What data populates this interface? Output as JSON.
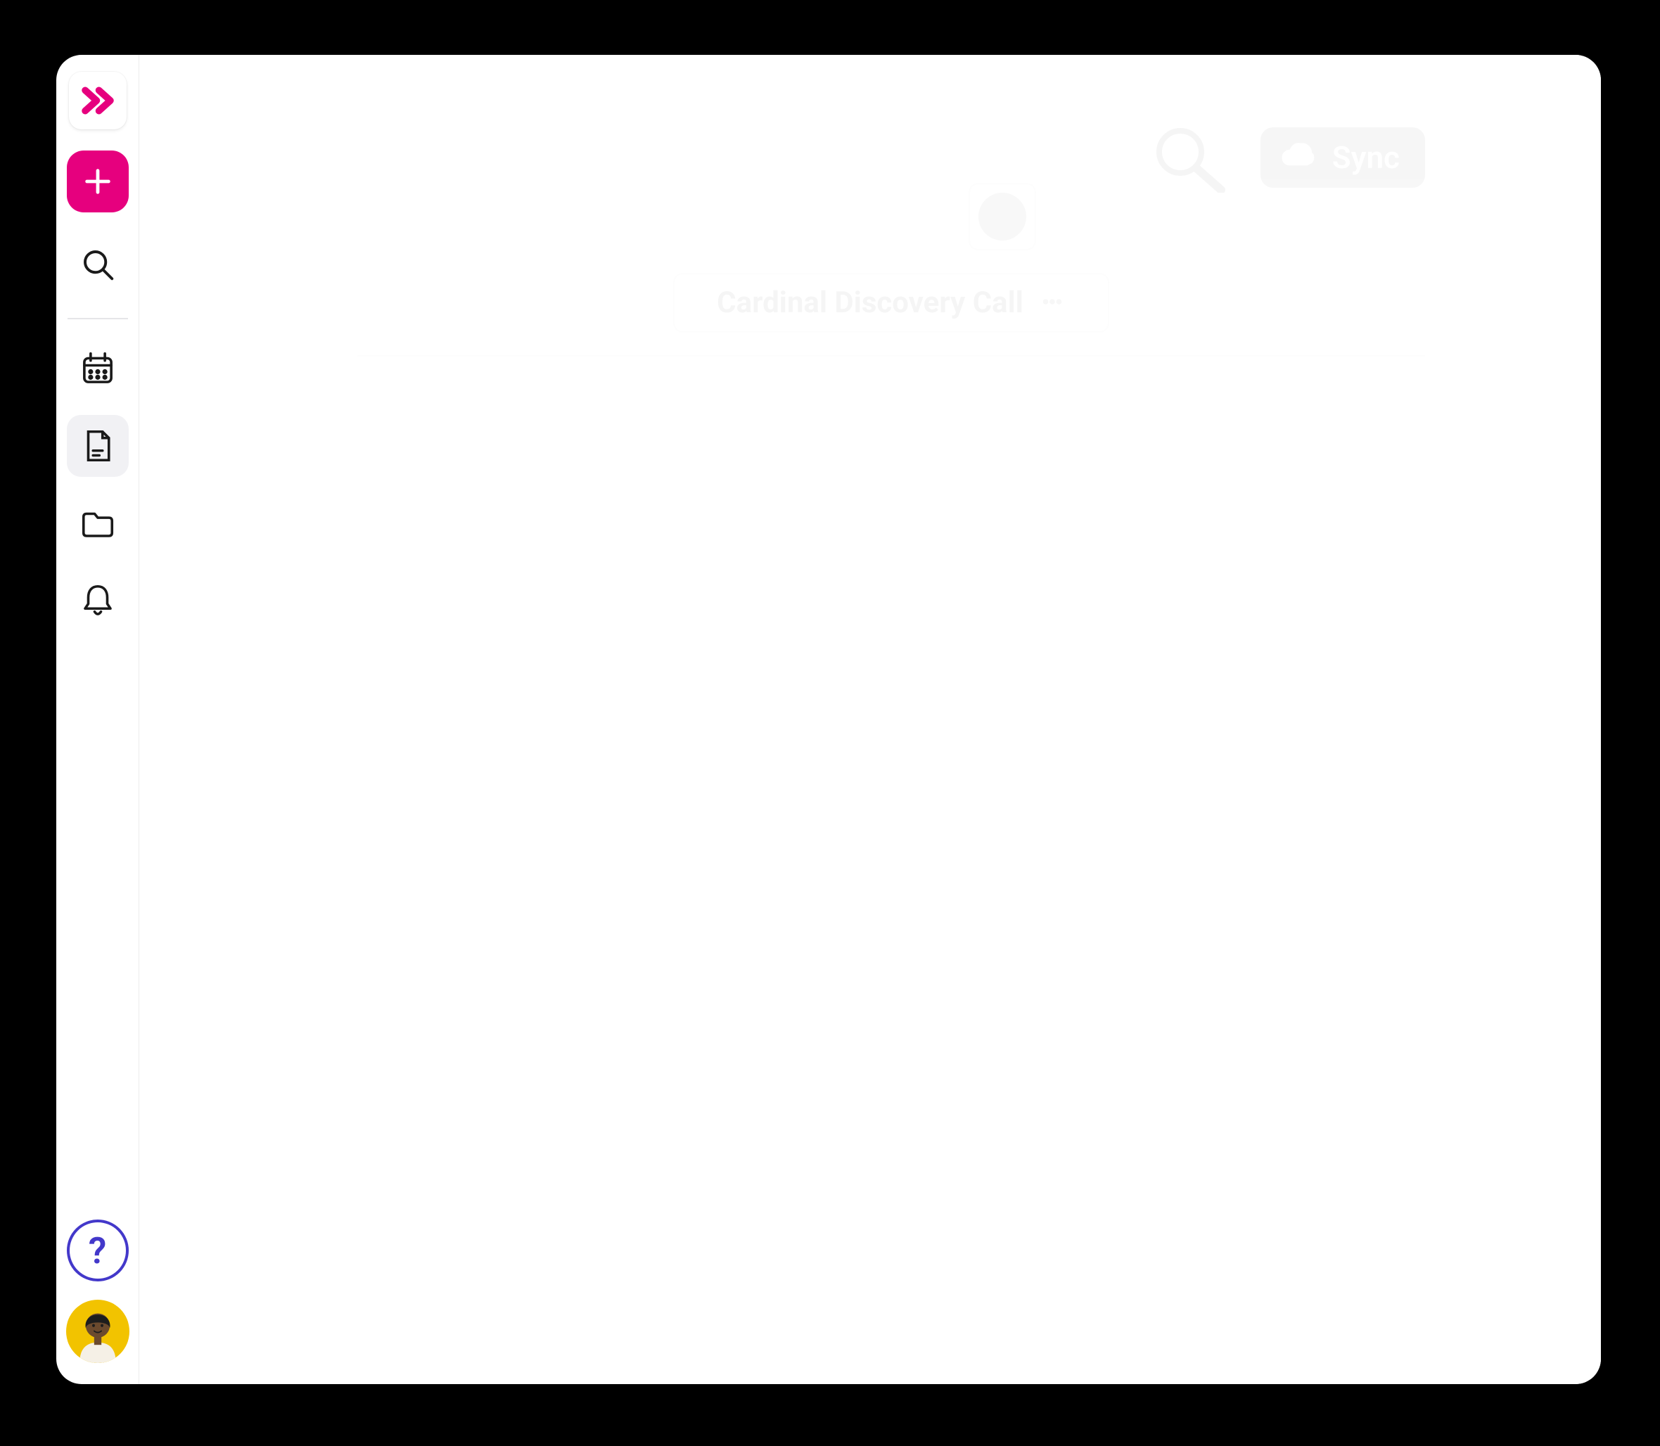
{
  "sidebar": {
    "logo_name": "app-logo",
    "new_label": "+",
    "items": [
      {
        "name": "search",
        "icon": "search-icon"
      },
      {
        "name": "calendar",
        "icon": "calendar-icon"
      },
      {
        "name": "notes",
        "icon": "note-icon",
        "active": true
      },
      {
        "name": "folders",
        "icon": "folder-icon"
      },
      {
        "name": "alerts",
        "icon": "bell-icon"
      }
    ],
    "help_label": "?"
  },
  "header": {
    "sync_label": "Sync"
  },
  "document": {
    "title": "Cardinal Discovery Call"
  },
  "colors": {
    "brand_pink": "#E6007E",
    "help_indigo": "#4338CA",
    "avatar_bg": "#F2C300"
  }
}
